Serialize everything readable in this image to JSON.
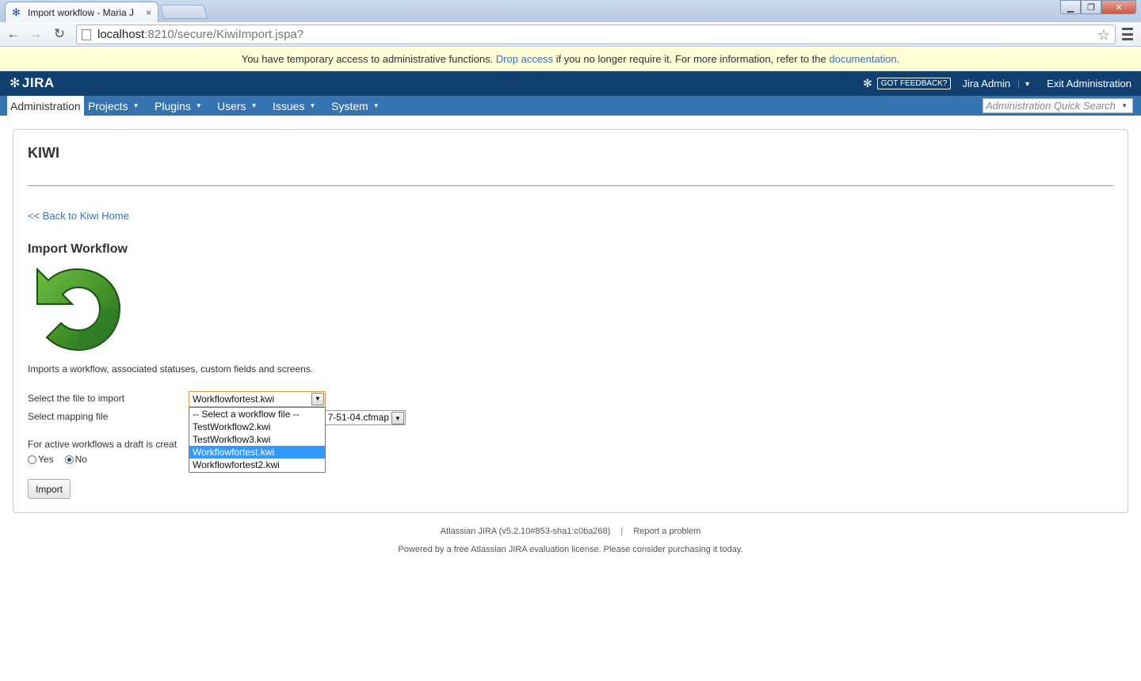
{
  "browser": {
    "tab_title": "Import workflow - Maria J",
    "tab_close": "×",
    "url_host": "localhost",
    "url_rest": ":8210/secure/KiwiImport.jspa?",
    "window_buttons": {
      "minimize": "▁",
      "maximize": "❐",
      "close": "✕"
    },
    "back": "←",
    "forward": "→",
    "reload": "↻",
    "star": "☆"
  },
  "warning": {
    "prefix": "You have temporary access to administrative functions.",
    "drop_access": "Drop access",
    "middle": "if you no longer require it. For more information, refer to the",
    "documentation": "documentation."
  },
  "header": {
    "logo": "JIRA",
    "feedback": "GOT FEEDBACK?",
    "user": "Jira Admin",
    "exit": "Exit Administration"
  },
  "nav": {
    "items": [
      {
        "label": "Administration"
      },
      {
        "label": "Projects"
      },
      {
        "label": "Plugins"
      },
      {
        "label": "Users"
      },
      {
        "label": "Issues"
      },
      {
        "label": "System"
      }
    ],
    "quick_search_placeholder": "Administration Quick Search"
  },
  "page": {
    "title": "KIWI",
    "back_link": "<< Back to Kiwi Home",
    "section_title": "Import Workflow",
    "description": "Imports a workflow, associated statuses, custom fields and screens.",
    "file_label": "Select the file to import",
    "file_selected": "Workflowfortest.kwi",
    "mapping_label": "Select mapping file",
    "mapping_selected_visible": "7-51-04.cfmap",
    "draft_label": "For active workflows a draft is creat",
    "radio_yes": "Yes",
    "radio_no": "No",
    "radio_selected": "No",
    "import_button": "Import",
    "file_options": [
      "-- Select a workflow file --",
      "TestWorkflow2.kwi",
      "TestWorkflow3.kwi",
      "Workflowfortest.kwi",
      "Workflowfortest2.kwi"
    ]
  },
  "footer": {
    "version": "Atlassian JIRA (v5.2.10#853-sha1:c0ba268)",
    "separator": "|",
    "report": "Report a problem",
    "license": "Powered by a free Atlassian JIRA evaluation license. Please consider purchasing it today."
  },
  "colors": {
    "header_bg": "#114070",
    "nav_bg": "#3572b0",
    "link": "#3b73af",
    "warning_bg": "#fffdd6",
    "selected_option": "#3399ff"
  }
}
